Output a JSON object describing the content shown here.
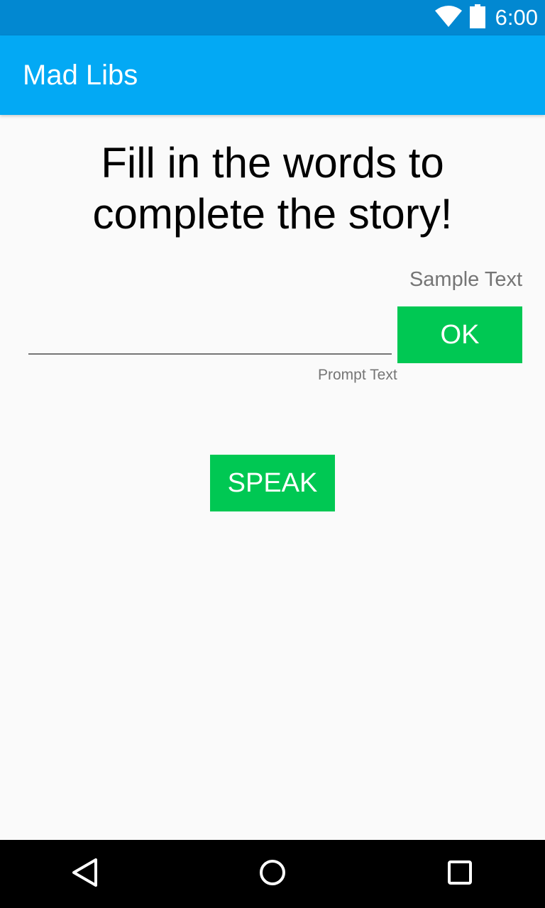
{
  "status_bar": {
    "time": "6:00",
    "icons": [
      "wifi-icon",
      "battery-icon"
    ]
  },
  "app_bar": {
    "title": "Mad Libs"
  },
  "main": {
    "headline": "Fill in the words to complete the story!",
    "sample_text": "Sample Text",
    "word_input": {
      "value": "",
      "placeholder": ""
    },
    "ok_label": "OK",
    "prompt_text": "Prompt Text",
    "speak_label": "SPEAK"
  },
  "nav_bar": {
    "icons": [
      "back-icon",
      "home-icon",
      "recents-icon"
    ]
  },
  "colors": {
    "status_bar": "#0288d1",
    "app_bar": "#03a9f4",
    "button_green": "#00c853",
    "secondary_text": "#757575",
    "background": "#fafafa"
  }
}
